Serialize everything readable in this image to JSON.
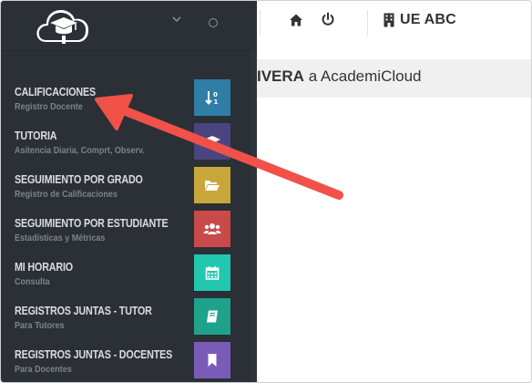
{
  "sidebar": {
    "logo_icon": "cloud-graduation-cap-icon",
    "collapse_icon": "chevron-down-icon",
    "toggle_icon": "circle-icon",
    "items": [
      {
        "title": "CALIFICACIONES",
        "subtitle": "Registro Docente",
        "icon": "sort-numeric-icon",
        "color": "#2f7ea6"
      },
      {
        "title": "TUTORIA",
        "subtitle": "Asitencia Diaria, Comprt, Observ.",
        "icon": "graduation-cap-icon",
        "color": "#4a4580"
      },
      {
        "title": "SEGUIMIENTO POR GRADO",
        "subtitle": "Registro de Calificaciones",
        "icon": "folder-open-icon",
        "color": "#c8a63a"
      },
      {
        "title": "SEGUIMIENTO POR ESTUDIANTE",
        "subtitle": "Estadísticas y Métricas",
        "icon": "users-icon",
        "color": "#c94a4a"
      },
      {
        "title": "MI HORARIO",
        "subtitle": "Consulta",
        "icon": "calendar-icon",
        "color": "#22c7b0"
      },
      {
        "title": "REGISTROS JUNTAS - TUTOR",
        "subtitle": "Para Tutores",
        "icon": "book-icon",
        "color": "#1fa28c"
      },
      {
        "title": "REGISTROS JUNTAS - DOCENTES",
        "subtitle": "Para Docentes",
        "icon": "bookmark-icon",
        "color": "#7a5cb8"
      }
    ]
  },
  "topbar": {
    "home_icon": "home-icon",
    "power_icon": "power-icon",
    "building_icon": "building-icon",
    "school_name": "UE ABC"
  },
  "welcome": {
    "name_fragment": "IVERA",
    "rest": " a AcademiCloud"
  },
  "annotation": {
    "arrow_color": "#f0524a"
  }
}
